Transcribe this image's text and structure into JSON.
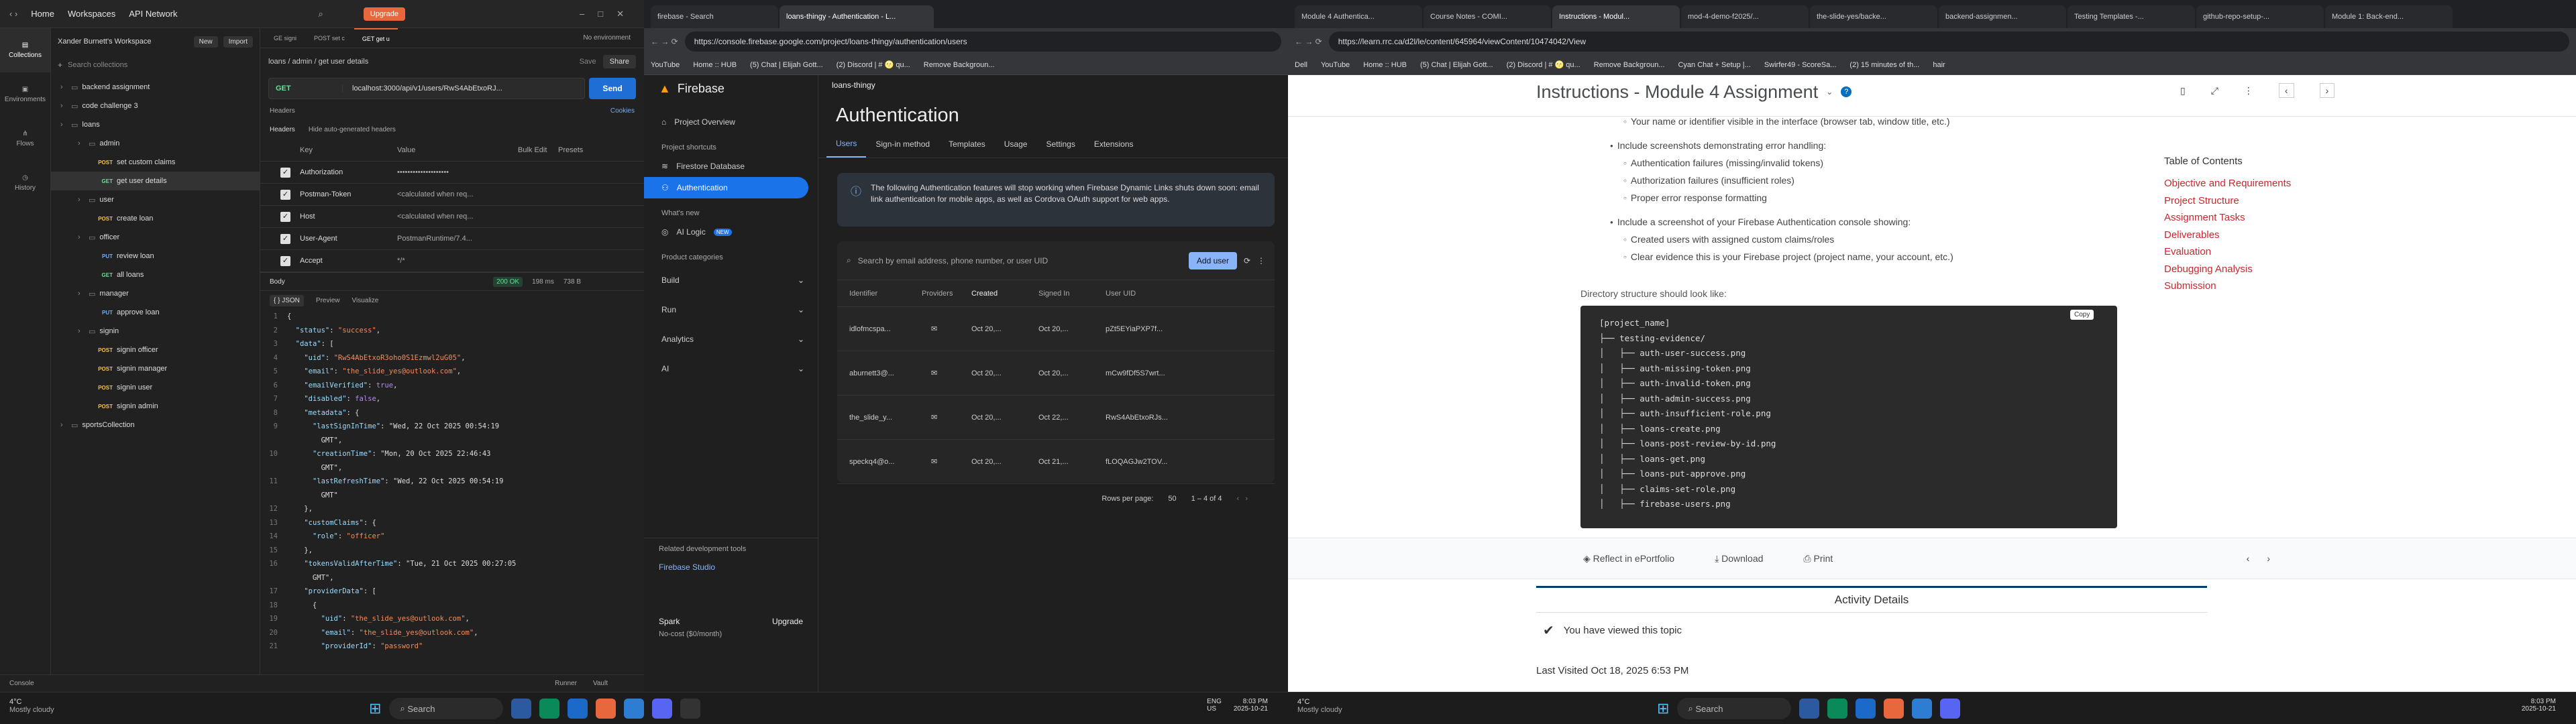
{
  "postman": {
    "nav_home": "Home",
    "nav_workspaces": "Workspaces",
    "nav_api": "API Network",
    "upgrade": "Upgrade",
    "env": "No environment",
    "workspace": "Xander Burnett's Workspace",
    "new": "New",
    "import": "Import",
    "search_placeholder": "Search collections",
    "rail": [
      "Collections",
      "Environments",
      "Flows",
      "History"
    ],
    "tree": [
      {
        "t": "folder",
        "label": "backend assignment",
        "indent": 0
      },
      {
        "t": "folder",
        "label": "code challenge 3",
        "indent": 0
      },
      {
        "t": "folder",
        "label": "loans",
        "indent": 0
      },
      {
        "t": "folder",
        "label": "admin",
        "indent": 1
      },
      {
        "t": "req",
        "m": "POST",
        "label": "set custom claims",
        "indent": 2
      },
      {
        "t": "req",
        "m": "GET",
        "label": "get user details",
        "indent": 2,
        "sel": true
      },
      {
        "t": "folder",
        "label": "user",
        "indent": 1
      },
      {
        "t": "req",
        "m": "POST",
        "label": "create loan",
        "indent": 2
      },
      {
        "t": "folder",
        "label": "officer",
        "indent": 1
      },
      {
        "t": "req",
        "m": "PUT",
        "label": "review loan",
        "indent": 2
      },
      {
        "t": "req",
        "m": "GET",
        "label": "all loans",
        "indent": 2
      },
      {
        "t": "folder",
        "label": "manager",
        "indent": 1
      },
      {
        "t": "req",
        "m": "PUT",
        "label": "approve loan",
        "indent": 2
      },
      {
        "t": "folder",
        "label": "signin",
        "indent": 1
      },
      {
        "t": "req",
        "m": "POST",
        "label": "signin officer",
        "indent": 2
      },
      {
        "t": "req",
        "m": "POST",
        "label": "signin manager",
        "indent": 2
      },
      {
        "t": "req",
        "m": "POST",
        "label": "signin user",
        "indent": 2
      },
      {
        "t": "req",
        "m": "POST",
        "label": "signin admin",
        "indent": 2
      },
      {
        "t": "folder",
        "label": "sportsCollection",
        "indent": 0
      }
    ],
    "tabs": [
      "GE signi",
      "POST set c",
      "GET get u"
    ],
    "breadcrumb": "loans / admin / get user details",
    "save": "Save",
    "share": "Share",
    "method": "GET",
    "url": "localhost:3000/api/v1/users/RwS4AbEtxoRJ...",
    "send": "Send",
    "headers_tab": "Headers",
    "cookies": "Cookies",
    "headers_label": "Headers",
    "hide_auto": "Hide auto-generated headers",
    "cols": [
      "Key",
      "Value",
      "Bulk Edit",
      "Presets"
    ],
    "header_rows": [
      [
        "Authorization",
        "••••••••••••••••••••"
      ],
      [
        "Postman-Token",
        "<calculated when req..."
      ],
      [
        "Host",
        "<calculated when req..."
      ],
      [
        "User-Agent",
        "PostmanRuntime/7.4..."
      ],
      [
        "Accept",
        "*/*"
      ]
    ],
    "body": "Body",
    "status": "200 OK",
    "time": "198 ms",
    "size": "738 B",
    "format": "{ } JSON",
    "preview": "Preview",
    "visualize": "Visualize",
    "json": [
      "{",
      "  \"status\": \"success\",",
      "  \"data\": [",
      "    \"uid\": \"RwS4AbEtxoR3oho0S1Ezmwl2uG05\",",
      "    \"email\": \"the_slide_yes@outlook.com\",",
      "    \"emailVerified\": true,",
      "    \"disabled\": false,",
      "    \"metadata\": {",
      "      \"lastSignInTime\": \"Wed, 22 Oct 2025 00:54:19",
      "        GMT\",",
      "      \"creationTime\": \"Mon, 20 Oct 2025 22:46:43",
      "        GMT\",",
      "      \"lastRefreshTime\": \"Wed, 22 Oct 2025 00:54:19",
      "        GMT\"",
      "    },",
      "    \"customClaims\": {",
      "      \"role\": \"officer\"",
      "    },",
      "    \"tokensValidAfterTime\": \"Tue, 21 Oct 2025 00:27:05",
      "      GMT\",",
      "    \"providerData\": [",
      "      {",
      "        \"uid\": \"the_slide_yes@outlook.com\",",
      "        \"email\": \"the_slide_yes@outlook.com\",",
      "        \"providerId\": \"password\""
    ],
    "json_nums": [
      "1",
      "2",
      "3",
      "4",
      "5",
      "6",
      "7",
      "8",
      "9",
      "",
      "10",
      "",
      "11",
      "",
      "12",
      "13",
      "14",
      "15",
      "16",
      "",
      "17",
      "18",
      "19",
      "20",
      "21"
    ],
    "console": "Console",
    "runner": "Runner",
    "vault": "Vault"
  },
  "firebase": {
    "tabs": [
      "firebase - Search",
      "loans-thingy - Authentication - L..."
    ],
    "url": "https://console.firebase.google.com/project/loans-thingy/authentication/users",
    "bookmarks": [
      "YouTube",
      "Home :: HUB",
      "(5) Chat | Elijah Gott...",
      "(2) Discord | # 🌝 qu...",
      "Remove Backgroun..."
    ],
    "brand": "Firebase",
    "project": "loans-thingy",
    "overview": "Project Overview",
    "shortcuts": "Project shortcuts",
    "firestore": "Firestore Database",
    "auth": "Authentication",
    "whatsnew": "What's new",
    "ailogic": "AI Logic",
    "newbadge": "NEW",
    "productcats": "Product categories",
    "cats": [
      "Build",
      "Run",
      "Analytics",
      "AI"
    ],
    "related": "Related development tools",
    "studio": "Firebase Studio",
    "plan": "Spark",
    "plan_cost": "No-cost ($0/month)",
    "upgrade": "Upgrade",
    "title": "Authentication",
    "ptabs": [
      "Users",
      "Sign-in method",
      "Templates",
      "Usage",
      "Settings",
      "Extensions"
    ],
    "banner": "The following Authentication features will stop working when Firebase Dynamic Links shuts down soon: email link authentication for mobile apps, as well as Cordova OAuth support for web apps.",
    "search_placeholder": "Search by email address, phone number, or user UID",
    "adduser": "Add user",
    "cols": [
      "Identifier",
      "Providers",
      "Created",
      "Signed In",
      "User UID"
    ],
    "users": [
      [
        "idlofmcspa...",
        "Oct 20,...",
        "Oct 20,...",
        "pZt5EYiaPXP7f..."
      ],
      [
        "aburnett3@...",
        "Oct 20,...",
        "Oct 20,...",
        "mCw9fDf5S7wrt..."
      ],
      [
        "the_slide_y...",
        "Oct 20,...",
        "Oct 22,...",
        "RwS4AbEtxoRJs..."
      ],
      [
        "speckq4@o...",
        "Oct 20,...",
        "Oct 21,...",
        "fLOQAGJw2TOV..."
      ]
    ],
    "rowspp": "Rows per page:",
    "rowsval": "50",
    "range": "1 – 4 of 4"
  },
  "learn": {
    "tabs": [
      "Module 4 Authentica...",
      "Course Notes - COMI...",
      "Instructions - Modul...",
      "mod-4-demo-f2025/...",
      "the-slide-yes/backe...",
      "backend-assignmen...",
      "Testing Templates -...",
      "github-repo-setup-...",
      "Module 1: Back-end..."
    ],
    "url": "https://learn.rrc.ca/d2l/le/content/645964/viewContent/10474042/View",
    "bookmarks": [
      "Dell",
      "YouTube",
      "Home :: HUB",
      "(5) Chat | Elijah Gott...",
      "(2) Discord | # 🌝 qu...",
      "Remove Backgroun...",
      "Cyan Chat + Setup |...",
      "Swirfer49 - ScoreSa...",
      "(2) 15 minutes of th...",
      "hair"
    ],
    "title": "Instructions - Module 4 Assignment",
    "bullets": [
      {
        "lvl": 2,
        "text": "Your name or identifier visible in the interface (browser tab, window title, etc.)"
      },
      {
        "lvl": 1,
        "text": "Include screenshots demonstrating error handling:"
      },
      {
        "lvl": 2,
        "text": "Authentication failures (missing/invalid tokens)"
      },
      {
        "lvl": 2,
        "text": "Authorization failures (insufficient roles)"
      },
      {
        "lvl": 2,
        "text": "Proper error response formatting"
      },
      {
        "lvl": 1,
        "text": "Include a screenshot of your Firebase Authentication console showing:"
      },
      {
        "lvl": 2,
        "text": "Created users with assigned custom claims/roles"
      },
      {
        "lvl": 2,
        "text": "Clear evidence this is your Firebase project (project name, your account, etc.)"
      }
    ],
    "dirlabel": "Directory structure should look like:",
    "copy": "Copy",
    "code": [
      "[project_name]",
      "├── testing-evidence/",
      "│   ├── auth-user-success.png",
      "│   ├── auth-missing-token.png",
      "│   ├── auth-invalid-token.png",
      "│   ├── auth-admin-success.png",
      "│   ├── auth-insufficient-role.png",
      "│   ├── loans-create.png",
      "│   ├── loans-post-review-by-id.png",
      "│   ├── loans-get.png",
      "│   ├── loans-put-approve.png",
      "│   ├── claims-set-role.png",
      "│   ├── firebase-users.png"
    ],
    "toc_title": "Table of Contents",
    "toc": [
      "Objective and Requirements",
      "Project Structure",
      "Assignment Tasks",
      "Deliverables",
      "Evaluation",
      "Debugging Analysis",
      "Submission"
    ],
    "reflect": "Reflect in ePortfolio",
    "download": "Download",
    "print": "Print",
    "activity": "Activity Details",
    "viewed": "You have viewed this topic",
    "lastvisited": "Last Visited Oct 18, 2025 6:53 PM"
  },
  "taskbar": {
    "temp": "4°C",
    "weather": "Mostly cloudy",
    "search": "Search",
    "lang": "ENG",
    "region": "US",
    "time": "8:03 PM",
    "date": "2025-10-21"
  }
}
